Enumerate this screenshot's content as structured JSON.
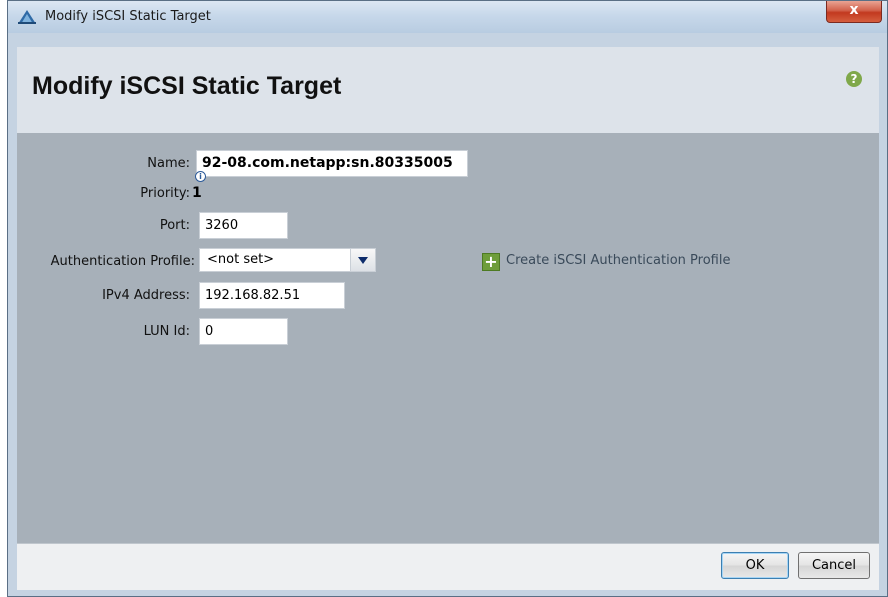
{
  "window": {
    "title": "Modify iSCSI Static Target",
    "close_glyph": "x"
  },
  "header": {
    "heading": "Modify iSCSI Static Target",
    "help_glyph": "?"
  },
  "form": {
    "name_label": "Name:",
    "name_value": "92-08.com.netapp:sn.80335005",
    "priority_label": "Priority:",
    "priority_value": "1",
    "port_label": "Port:",
    "port_value": "3260",
    "auth_label": "Authentication Profile:",
    "auth_selected": "<not set>",
    "create_auth_label": "Create iSCSI Authentication Profile",
    "ipv4_label": "IPv4 Address:",
    "ipv4_value": "192.168.82.51",
    "lun_label": "LUN Id:",
    "lun_value": "0"
  },
  "footer": {
    "ok_label": "OK",
    "cancel_label": "Cancel"
  },
  "icons": {
    "app": "ucs-manager-icon",
    "help": "help-icon",
    "info": "info-icon",
    "add": "plus-icon"
  },
  "colors": {
    "content_bg": "#a7b0b9",
    "header_bg": "#dde3ea",
    "close_red": "#c2391f",
    "plus_green": "#6e9d3a"
  }
}
